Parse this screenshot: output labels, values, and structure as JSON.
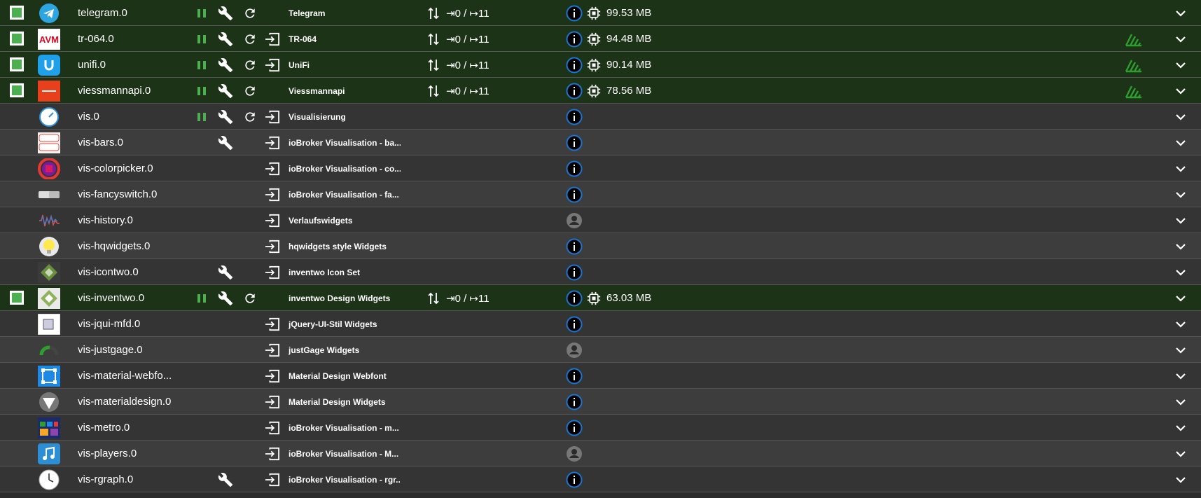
{
  "colors": {
    "running_row": "#1c3317",
    "row_a": "#343434",
    "row_b": "#3d3d3d",
    "accent_green": "#4caf50",
    "info_blue": "#1976d2",
    "signal_green": "#2e9e2e"
  },
  "instances": [
    {
      "name": "telegram.0",
      "title": "Telegram",
      "running": true,
      "controls": [
        "pause",
        "wrench",
        "reload"
      ],
      "io": "⇥0 / ↦11",
      "memory": "99.53 MB",
      "status": "info",
      "signal": false,
      "logo": "telegram-logo"
    },
    {
      "name": "tr-064.0",
      "title": "TR-064",
      "running": true,
      "controls": [
        "pause",
        "wrench",
        "reload",
        "enter"
      ],
      "io": "⇥0 / ↦11",
      "memory": "94.48 MB",
      "status": "info",
      "signal": true,
      "logo": "avm-logo"
    },
    {
      "name": "unifi.0",
      "title": "UniFi",
      "running": true,
      "controls": [
        "pause",
        "wrench",
        "reload",
        "enter"
      ],
      "io": "⇥0 / ↦11",
      "memory": "90.14 MB",
      "status": "info",
      "signal": true,
      "logo": "unifi-logo"
    },
    {
      "name": "viessmannapi.0",
      "title": "Viessmannapi",
      "running": true,
      "controls": [
        "pause",
        "wrench",
        "reload"
      ],
      "io": "⇥0 / ↦11",
      "memory": "78.56 MB",
      "status": "info",
      "signal": true,
      "logo": "viessmann-logo"
    },
    {
      "name": "vis.0",
      "title": "Visualisierung",
      "running": false,
      "controls": [
        "pause",
        "wrench",
        "reload",
        "enter"
      ],
      "io": "",
      "memory": "",
      "status": "info",
      "signal": false,
      "logo": "vis-logo"
    },
    {
      "name": "vis-bars.0",
      "title": "ioBroker Visualisation - ba...",
      "running": false,
      "controls": [
        "wrench",
        "enter"
      ],
      "io": "",
      "memory": "",
      "status": "info",
      "signal": false,
      "logo": "vis-bars-logo"
    },
    {
      "name": "vis-colorpicker.0",
      "title": "ioBroker Visualisation - co...",
      "running": false,
      "controls": [
        "enter"
      ],
      "io": "",
      "memory": "",
      "status": "info",
      "signal": false,
      "logo": "colorpicker-logo"
    },
    {
      "name": "vis-fancyswitch.0",
      "title": "ioBroker Visualisation - fa...",
      "running": false,
      "controls": [
        "enter"
      ],
      "io": "",
      "memory": "",
      "status": "info",
      "signal": false,
      "logo": "fancyswitch-logo"
    },
    {
      "name": "vis-history.0",
      "title": "Verlaufswidgets",
      "running": false,
      "controls": [
        "enter"
      ],
      "io": "",
      "memory": "",
      "status": "user",
      "signal": false,
      "logo": "history-logo"
    },
    {
      "name": "vis-hqwidgets.0",
      "title": "hqwidgets style Widgets",
      "running": false,
      "controls": [
        "enter"
      ],
      "io": "",
      "memory": "",
      "status": "info",
      "signal": false,
      "logo": "hqwidgets-logo"
    },
    {
      "name": "vis-icontwo.0",
      "title": "inventwo Icon Set",
      "running": false,
      "controls": [
        "wrench",
        "enter"
      ],
      "io": "",
      "memory": "",
      "status": "info",
      "signal": false,
      "logo": "icontwo-logo"
    },
    {
      "name": "vis-inventwo.0",
      "title": "inventwo Design Widgets",
      "running": true,
      "controls": [
        "pause",
        "wrench",
        "reload"
      ],
      "io": "⇥0 / ↦11",
      "memory": "63.03 MB",
      "status": "info",
      "signal": false,
      "logo": "inventwo-logo"
    },
    {
      "name": "vis-jqui-mfd.0",
      "title": "jQuery-UI-Stil Widgets",
      "running": false,
      "controls": [
        "enter"
      ],
      "io": "",
      "memory": "",
      "status": "info",
      "signal": false,
      "logo": "jqui-logo"
    },
    {
      "name": "vis-justgage.0",
      "title": "justGage Widgets",
      "running": false,
      "controls": [
        "enter"
      ],
      "io": "",
      "memory": "",
      "status": "user",
      "signal": false,
      "logo": "justgage-logo"
    },
    {
      "name": "vis-material-webfo...",
      "title": "Material Design Webfont",
      "running": false,
      "controls": [
        "enter"
      ],
      "io": "",
      "memory": "",
      "status": "info",
      "signal": false,
      "logo": "material-webfont-logo"
    },
    {
      "name": "vis-materialdesign.0",
      "title": "Material Design Widgets",
      "running": false,
      "controls": [
        "enter"
      ],
      "io": "",
      "memory": "",
      "status": "info",
      "signal": false,
      "logo": "materialdesign-logo"
    },
    {
      "name": "vis-metro.0",
      "title": "ioBroker Visualisation - m...",
      "running": false,
      "controls": [
        "enter"
      ],
      "io": "",
      "memory": "",
      "status": "info",
      "signal": false,
      "logo": "metro-logo"
    },
    {
      "name": "vis-players.0",
      "title": "ioBroker Visualisation - M...",
      "running": false,
      "controls": [
        "enter"
      ],
      "io": "",
      "memory": "",
      "status": "user",
      "signal": false,
      "logo": "players-logo"
    },
    {
      "name": "vis-rgraph.0",
      "title": "ioBroker Visualisation - rgr...",
      "running": false,
      "controls": [
        "wrench",
        "enter"
      ],
      "io": "",
      "memory": "",
      "status": "info",
      "signal": false,
      "logo": "rgraph-logo"
    }
  ]
}
